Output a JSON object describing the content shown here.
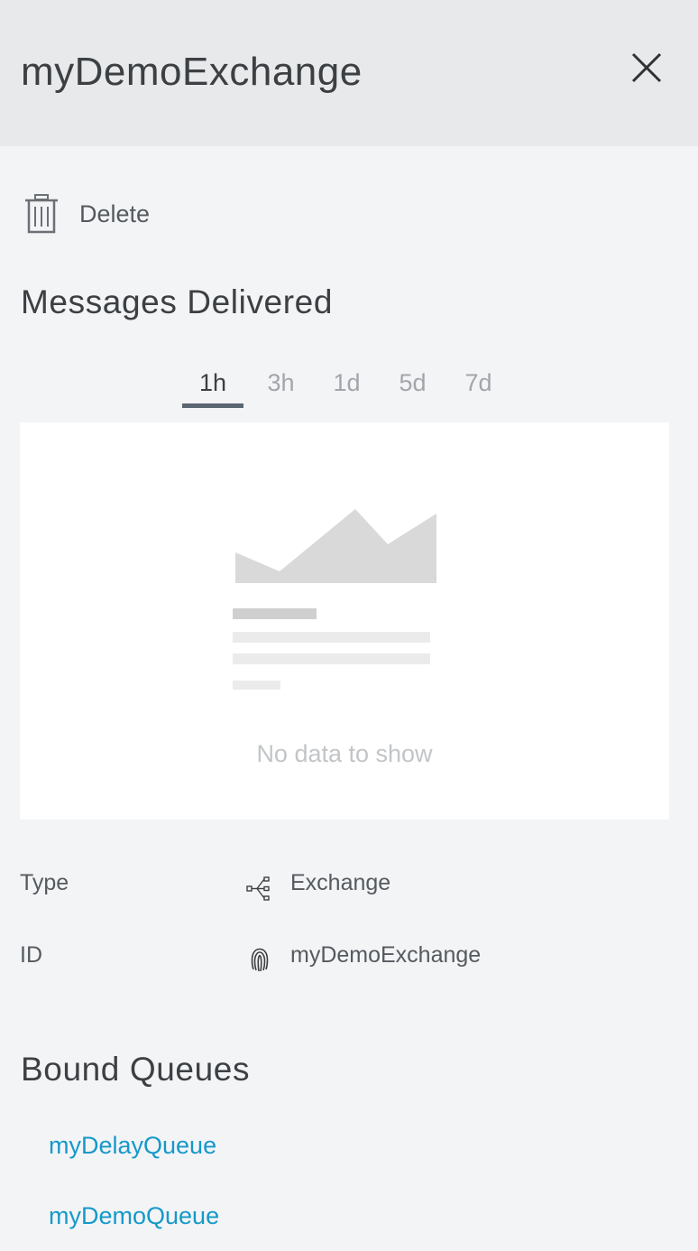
{
  "panel": {
    "title": "myDemoExchange",
    "close_icon": "close-icon"
  },
  "actions": {
    "delete_label": "Delete",
    "delete_icon": "trash-icon"
  },
  "messages_delivered": {
    "title": "Messages Delivered",
    "tabs": [
      {
        "label": "1h",
        "active": true
      },
      {
        "label": "3h",
        "active": false
      },
      {
        "label": "1d",
        "active": false
      },
      {
        "label": "5d",
        "active": false
      },
      {
        "label": "7d",
        "active": false
      }
    ],
    "empty_text": "No data to show"
  },
  "properties": {
    "type_label": "Type",
    "type_value": "Exchange",
    "type_icon": "exchange-icon",
    "id_label": "ID",
    "id_value": "myDemoExchange",
    "id_icon": "fingerprint-icon"
  },
  "bound_queues": {
    "title": "Bound Queues",
    "items": [
      "myDelayQueue",
      "myDemoQueue"
    ]
  },
  "colors": {
    "header_bg": "#e8e9eb",
    "panel_bg": "#f3f4f6",
    "link": "#1599c9",
    "active_tab_underline": "#5a6670"
  }
}
